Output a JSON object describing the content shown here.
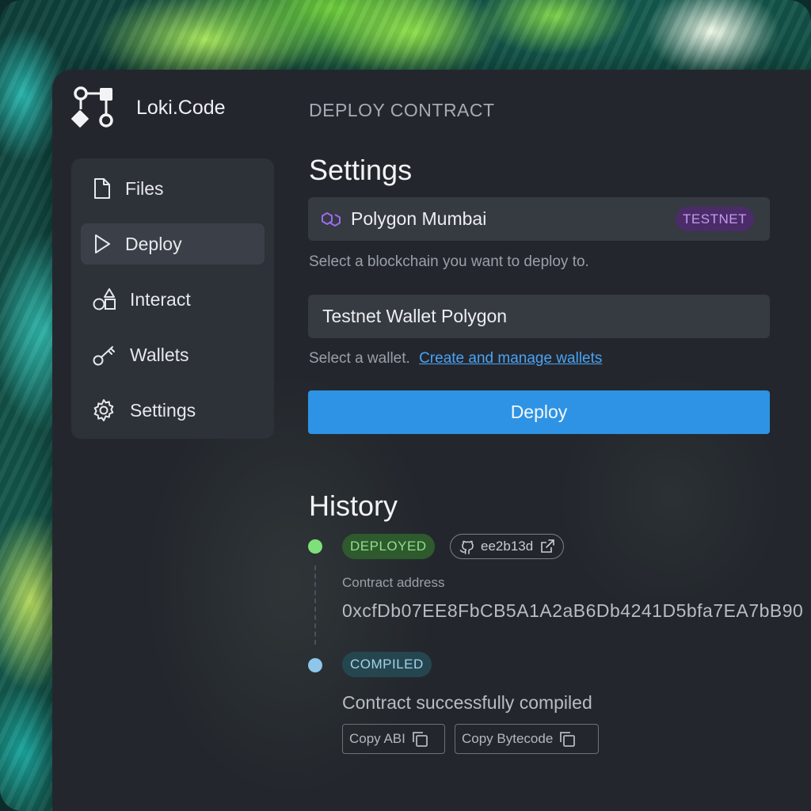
{
  "app": {
    "name": "Loki.Code"
  },
  "sidebar": {
    "items": [
      {
        "label": "Files",
        "icon": "file-icon",
        "active": false
      },
      {
        "label": "Deploy",
        "icon": "play-icon",
        "active": true
      },
      {
        "label": "Interact",
        "icon": "shapes-icon",
        "active": false
      },
      {
        "label": "Wallets",
        "icon": "key-icon",
        "active": false
      },
      {
        "label": "Settings",
        "icon": "gear-icon",
        "active": false
      }
    ]
  },
  "main": {
    "breadcrumb": "DEPLOY CONTRACT",
    "settings_title": "Settings",
    "network": {
      "value": "Polygon Mumbai",
      "badge": "TESTNET",
      "icon": "polygon-icon"
    },
    "network_hint": "Select a blockchain you want to deploy to.",
    "wallet": {
      "value": "Testnet Wallet Polygon"
    },
    "wallet_hint": "Select a wallet.",
    "wallet_link": "Create and manage wallets",
    "deploy_label": "Deploy",
    "history_title": "History",
    "history": {
      "deployed": {
        "badge": "DEPLOYED",
        "commit": "ee2b13d",
        "address_label": "Contract address",
        "address": "0xcfDb07EE8FbCB5A1A2aB6Db4241D5bfa7EA7bB90"
      },
      "compiled": {
        "badge": "COMPILED",
        "message": "Contract successfully compiled",
        "copy_abi": "Copy ABI",
        "copy_bytecode": "Copy Bytecode"
      }
    }
  },
  "colors": {
    "accent": "#2e93e4",
    "deployed": "#7ee07a",
    "compiled": "#8ec7ea",
    "testnet": "#c59af0",
    "link": "#4ba3f5"
  }
}
